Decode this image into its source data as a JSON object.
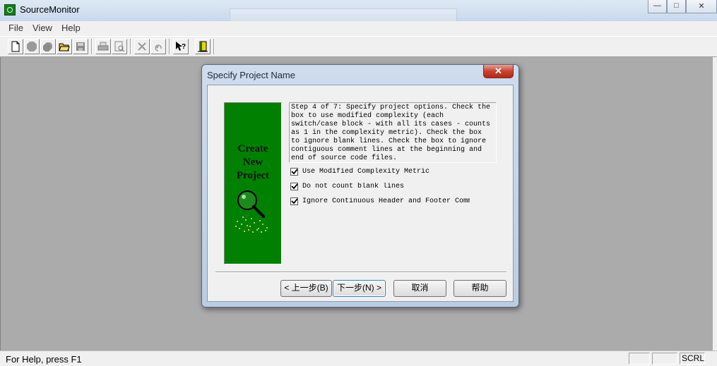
{
  "app": {
    "title": "SourceMonitor"
  },
  "window_controls": {
    "minimize": "—",
    "maximize": "□",
    "close": "✕"
  },
  "menu": {
    "items": [
      "File",
      "View",
      "Help"
    ]
  },
  "toolbar": {
    "icons": [
      "new-file-icon",
      "stop-icon",
      "stop-all-icon",
      "open-folder-icon",
      "save-icon",
      "print-icon",
      "print-preview-icon",
      "delete-icon",
      "undo-icon",
      "context-help-icon",
      "exit-icon"
    ]
  },
  "dialog": {
    "title": "Specify Project Name",
    "close_glyph": "✕",
    "banner": {
      "line1": "Create",
      "line2": "New",
      "line3": "Project"
    },
    "step_text": "Step 4 of 7: Specify project options. Check the box to use modified complexity (each switch/case block - with all its cases - counts as 1 in the complexity metric). Check the box to ignore blank lines. Check the box to ignore contiguous comment lines at the beginning and end of source code files.",
    "options": [
      {
        "label": "Use Modified Complexity Metric",
        "checked": true
      },
      {
        "label": "Do not count blank lines",
        "checked": true
      },
      {
        "label": "Ignore Continuous Header and Footer Comm",
        "checked": true
      }
    ],
    "buttons": {
      "back": "< 上一步(B)",
      "next": "下一步(N) >",
      "cancel": "取消",
      "help": "帮助"
    }
  },
  "status": {
    "text": "For Help, press F1",
    "indicator": "SCRL"
  }
}
